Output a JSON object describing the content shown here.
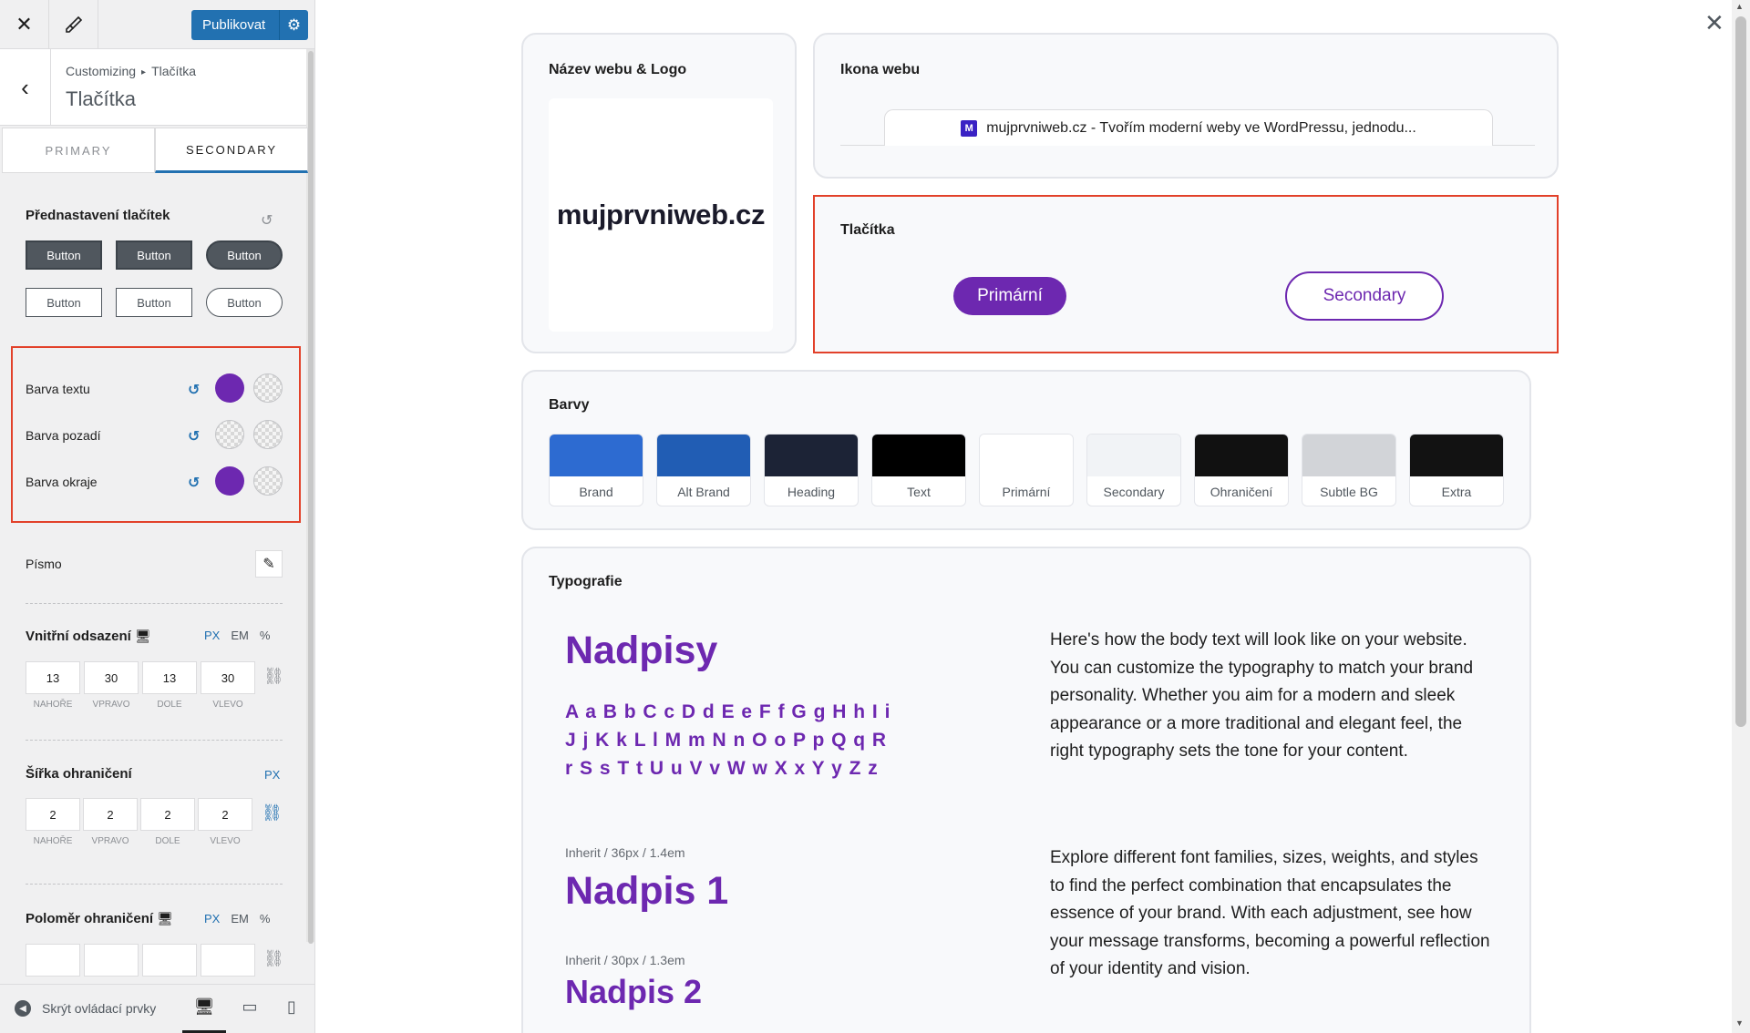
{
  "topbar": {
    "close_icon": "close-icon",
    "brush_icon": "brush-icon",
    "publish_label": "Publikovat",
    "settings_icon": "gear-icon"
  },
  "header": {
    "breadcrumb_root": "Customizing",
    "breadcrumb_current": "Tlačítka",
    "title": "Tlačítka"
  },
  "tabs": [
    {
      "label": "PRIMARY",
      "active": false
    },
    {
      "label": "SECONDARY",
      "active": true
    }
  ],
  "presets": {
    "title": "Přednastavení tlačítek",
    "buttons": [
      "Button",
      "Button",
      "Button",
      "Button",
      "Button",
      "Button"
    ]
  },
  "colors": {
    "text_label": "Barva textu",
    "bg_label": "Barva pozadí",
    "border_label": "Barva okraje",
    "accent": "#6d28b0"
  },
  "font": {
    "label": "Písmo"
  },
  "padding": {
    "title": "Vnitřní odsazení",
    "units": [
      "PX",
      "EM",
      "%"
    ],
    "values": [
      "13",
      "30",
      "13",
      "30"
    ],
    "labels": [
      "NAHOŘE",
      "VPRAVO",
      "DOLE",
      "VLEVO"
    ]
  },
  "border_width": {
    "title": "Šířka ohraničení",
    "unit": "PX",
    "values": [
      "2",
      "2",
      "2",
      "2"
    ],
    "labels": [
      "NAHOŘE",
      "VPRAVO",
      "DOLE",
      "VLEVO"
    ]
  },
  "border_radius": {
    "title": "Poloměr ohraničení",
    "units": [
      "PX",
      "EM",
      "%"
    ]
  },
  "footer": {
    "hide_controls": "Skrýt ovládací prvky"
  },
  "preview": {
    "site_title_card": "Název webu & Logo",
    "logo_text": "mujprvniweb.cz",
    "site_icon_card": "Ikona webu",
    "browser_tab_text": "mujprvniweb.cz - Tvořím moderní weby ve WordPressu, jednodu...",
    "favicon_letter": "M",
    "buttons_card": "Tlačítka",
    "primary_button": "Primární",
    "secondary_button": "Secondary",
    "colors_card": "Barvy",
    "palette": [
      {
        "name": "Brand",
        "color": "#2d6bd1"
      },
      {
        "name": "Alt Brand",
        "color": "#215db4"
      },
      {
        "name": "Heading",
        "color": "#1c2336"
      },
      {
        "name": "Text",
        "color": "#000000"
      },
      {
        "name": "Primární",
        "color": "#ffffff"
      },
      {
        "name": "Secondary",
        "color": "#f1f3f6"
      },
      {
        "name": "Ohraničení",
        "color": "#111111"
      },
      {
        "name": "Subtle BG",
        "color": "#d2d4d8"
      },
      {
        "name": "Extra",
        "color": "#121212"
      }
    ],
    "typography_card": "Typografie",
    "headings_title": "Nadpisy",
    "alphabet": "A a B b C c D d E e F f G g H h I i J j K k L l M m N n O o P p Q q R r S s T t U u V v W w X x Y y Z z",
    "body_text_1": "Here's how the body text will look like on your website. You can customize the typography to match your brand personality. Whether you aim for a modern and sleek appearance or a more traditional and elegant feel, the right typography sets the tone for your content.",
    "h1_meta": "Inherit / 36px / 1.4em",
    "h1_text": "Nadpis 1",
    "body_text_2": "Explore different font families, sizes, weights, and styles to find the perfect combination that encapsulates the essence of your brand. With each adjustment, see how your message transforms, becoming a powerful reflection of your identity and vision.",
    "h2_meta": "Inherit / 30px / 1.3em",
    "h2_text": "Nadpis 2"
  }
}
